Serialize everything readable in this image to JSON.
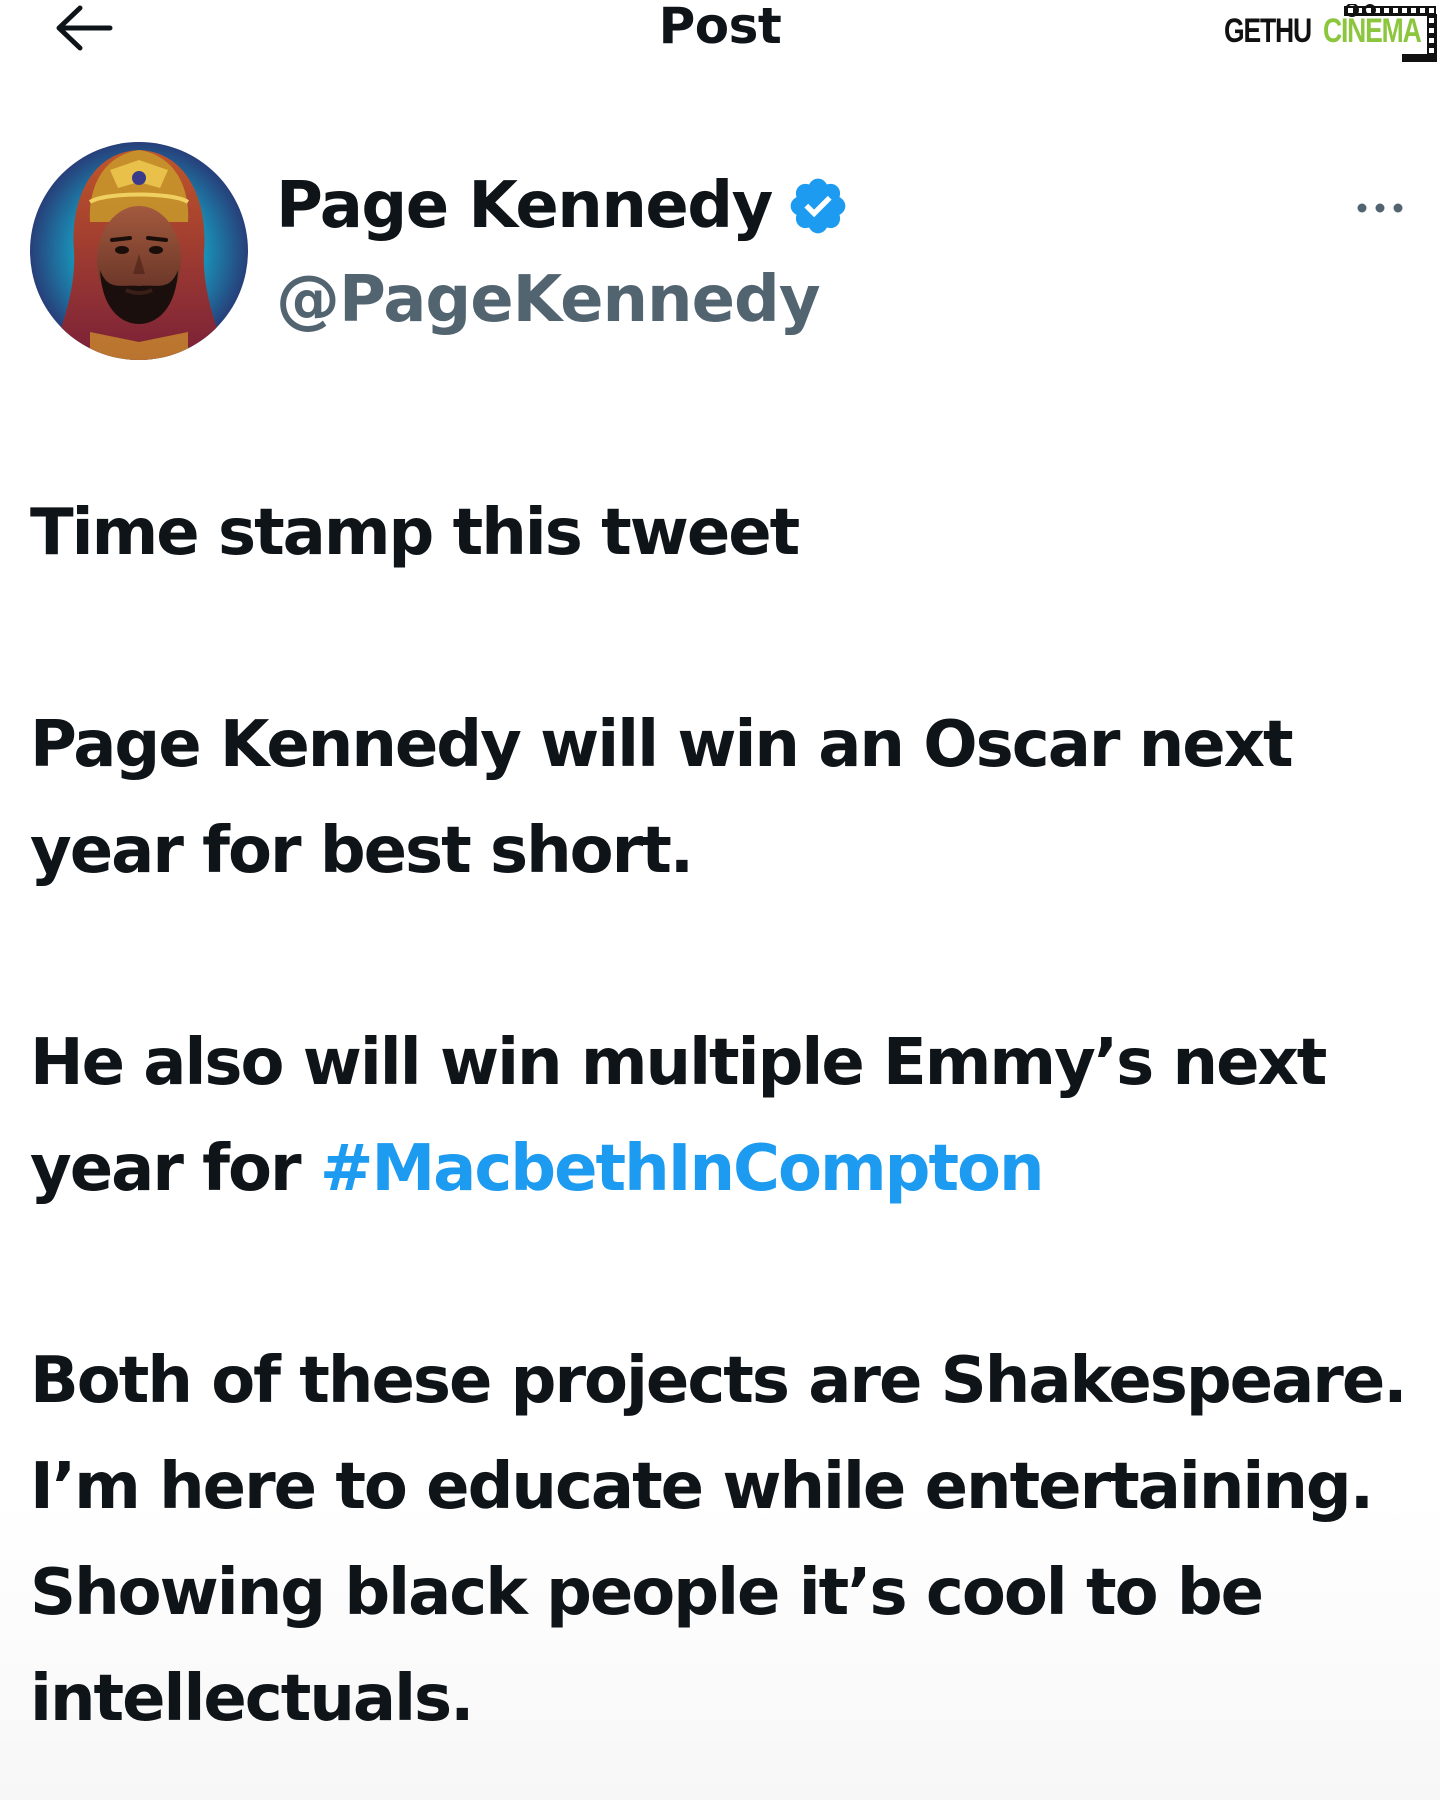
{
  "header": {
    "title": "Post",
    "back_icon": "arrow-left-icon"
  },
  "watermark": {
    "part1": "GETHU",
    "part2": "CINEMA",
    "colors": {
      "part1": "#111111",
      "part2": "#8cc63f"
    }
  },
  "author": {
    "name": "Page Kennedy",
    "handle": "@PageKennedy",
    "verified": true,
    "verified_icon": "verified-badge-icon",
    "avatar_icon": "avatar"
  },
  "more_icon": "more-dots-icon",
  "tweet": {
    "line1": "Time stamp this tweet",
    "line2": "Page Kennedy will win an Oscar next year for best short.",
    "line3_text": "He also will win multiple Emmy’s next year for ",
    "line3_hashtag": "#MacbethInCompton",
    "line4": "Both of these projects are Shakespeare. I’m here to educate while entertaining. Showing black people it’s cool to be intellectuals."
  },
  "colors": {
    "text": "#0f1419",
    "secondary": "#536471",
    "accent": "#1d9bf0"
  }
}
